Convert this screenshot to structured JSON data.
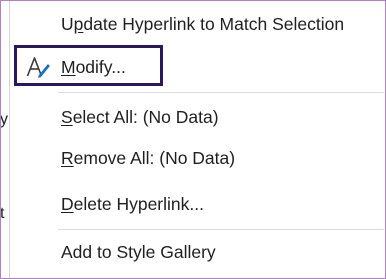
{
  "menu": {
    "items": [
      {
        "pre": "",
        "ul": "",
        "post": "Update Hyperlink to Match Selection",
        "ul_char": "U",
        "full": "Update Hyperlink to Match Selection"
      },
      {
        "pre": "",
        "ul": "M",
        "post": "odify...",
        "full": "Modify..."
      },
      {
        "pre": "",
        "ul": "S",
        "post": "elect All: (No Data)",
        "full": "Select All: (No Data)"
      },
      {
        "pre": "",
        "ul": "R",
        "post": "emove All: (No Data)",
        "full": "Remove All: (No Data)"
      },
      {
        "pre": "",
        "ul": "D",
        "post": "elete Hyperlink...",
        "full": "Delete Hyperlink..."
      },
      {
        "pre": "",
        "ul": "",
        "post": "Add to Style Gallery",
        "full": "Add to Style Gallery"
      }
    ],
    "update_parts": {
      "a": "U",
      "b": "p",
      "c": "date Hyperlink to Match Selection"
    }
  },
  "icons": {
    "modify": "style-pen-icon"
  },
  "colors": {
    "highlight_border": "#2a175e",
    "icon_blue": "#1b6fc7",
    "outer_border": "#b07fc7"
  },
  "background_text": {
    "fragment_1": "y",
    "fragment_2": "t"
  }
}
